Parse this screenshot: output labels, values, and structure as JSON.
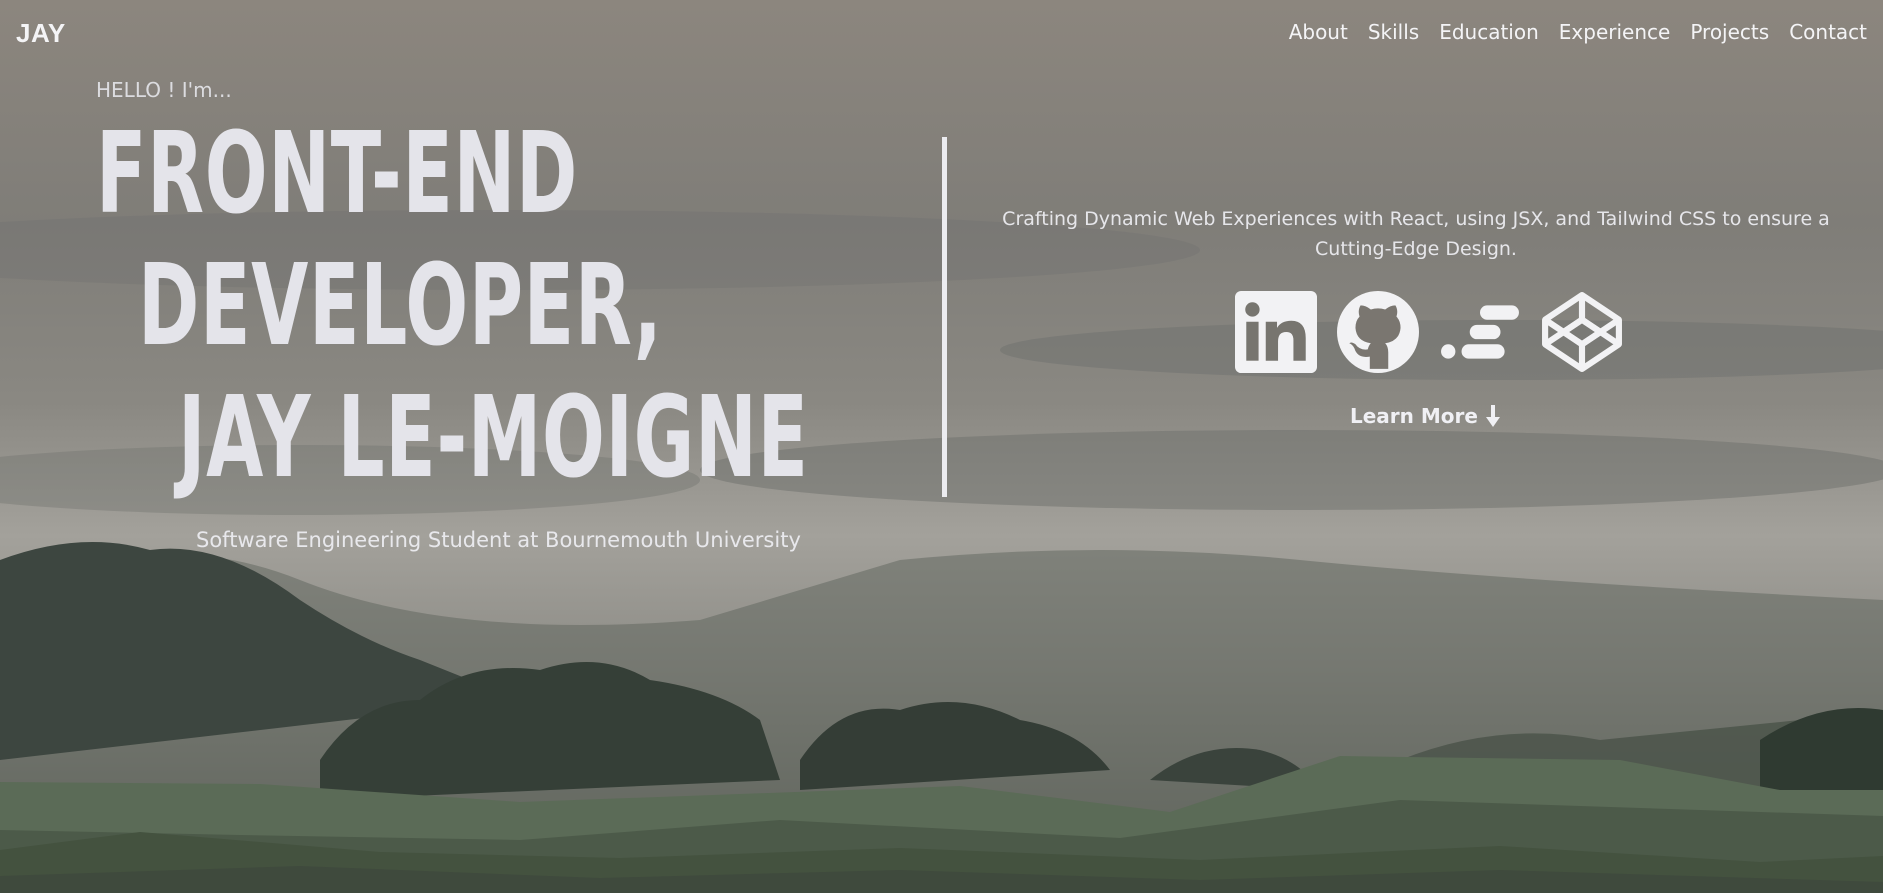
{
  "nav": {
    "brand": "JAY",
    "links": [
      "About",
      "Skills",
      "Education",
      "Experience",
      "Projects",
      "Contact"
    ]
  },
  "hero": {
    "greeting": "HELLO ! I'm...",
    "headline": [
      "FRONT-END",
      "DEVELOPER,",
      "JAY LE-MOIGNE"
    ],
    "subtitle": "Software Engineering Student at Bournemouth University",
    "tagline": "Crafting Dynamic Web Experiences with React, using JSX, and Tailwind CSS to ensure a Cutting-Edge Design.",
    "learn_more": "Learn More"
  },
  "socials": [
    {
      "icon": "linkedin-icon"
    },
    {
      "icon": "github-icon"
    },
    {
      "icon": "devto-icon"
    },
    {
      "icon": "codepen-icon"
    }
  ],
  "colors": {
    "text": "#e4e4ea",
    "hills_dark": "#3f4a3d",
    "hills_mid": "#4c5a49",
    "hills_light": "#5b6b57"
  }
}
